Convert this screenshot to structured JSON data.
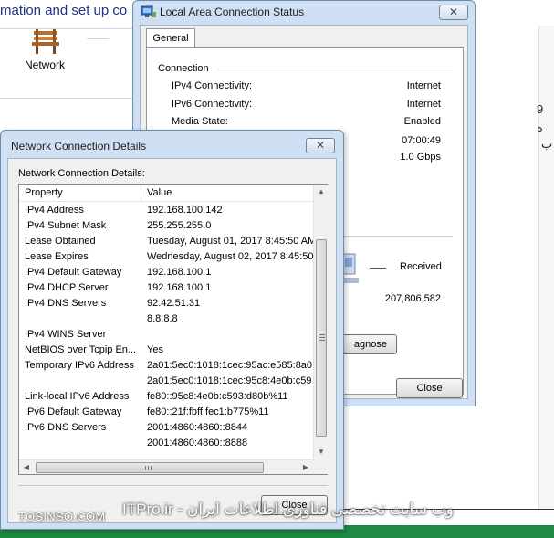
{
  "background": {
    "heading": "mation and set up co",
    "network_label": "Network",
    "right_text_1": "9",
    "right_text_2": "ه",
    "right_text_3": "ب"
  },
  "status_window": {
    "title": "Local Area Connection Status",
    "close_glyph": "✕",
    "tab": "General",
    "connection_label": "Connection",
    "rows": [
      {
        "key": "IPv4 Connectivity:",
        "value": "Internet"
      },
      {
        "key": "IPv6 Connectivity:",
        "value": "Internet"
      },
      {
        "key": "Media State:",
        "value": "Enabled"
      },
      {
        "key": "",
        "value": "07:00:49"
      },
      {
        "key": "",
        "value": "1.0 Gbps"
      }
    ],
    "received_label": "Received",
    "received_bytes": "207,806,582",
    "diagnose_label": "agnose",
    "close_button": "Close"
  },
  "details_window": {
    "title": "Network Connection Details",
    "close_glyph": "✕",
    "caption": "Network Connection Details:",
    "columns": {
      "property": "Property",
      "value": "Value"
    },
    "rows": [
      {
        "property": "IPv4 Address",
        "value": "192.168.100.142"
      },
      {
        "property": "IPv4 Subnet Mask",
        "value": "255.255.255.0"
      },
      {
        "property": "Lease Obtained",
        "value": "Tuesday, August 01, 2017 8:45:50 AM"
      },
      {
        "property": "Lease Expires",
        "value": "Wednesday, August 02, 2017 8:45:50"
      },
      {
        "property": "IPv4 Default Gateway",
        "value": "192.168.100.1"
      },
      {
        "property": "IPv4 DHCP Server",
        "value": "192.168.100.1"
      },
      {
        "property": "IPv4 DNS Servers",
        "value": "92.42.51.31"
      },
      {
        "property": "",
        "value": "8.8.8.8"
      },
      {
        "property": "IPv4 WINS Server",
        "value": ""
      },
      {
        "property": "NetBIOS over Tcpip En...",
        "value": "Yes"
      },
      {
        "property": "Temporary IPv6 Address",
        "value": "2a01:5ec0:1018:1cec:95ac:e585:8a0"
      },
      {
        "property": "",
        "value": "2a01:5ec0:1018:1cec:95c8:4e0b:c59"
      },
      {
        "property": "Link-local IPv6 Address",
        "value": "fe80::95c8:4e0b:c593:d80b%11"
      },
      {
        "property": "IPv6 Default Gateway",
        "value": "fe80::21f:fbff:fec1:b775%11"
      },
      {
        "property": "IPv6 DNS Servers",
        "value": "2001:4860:4860::8844"
      },
      {
        "property": "",
        "value": "2001:4860:4860::8888"
      }
    ],
    "close_button": "Close"
  },
  "watermark": {
    "left": "TOSINSO.COM",
    "right": "ITPro.ir - وب سایت تخصصی فناوری اطلاعات ایران"
  }
}
